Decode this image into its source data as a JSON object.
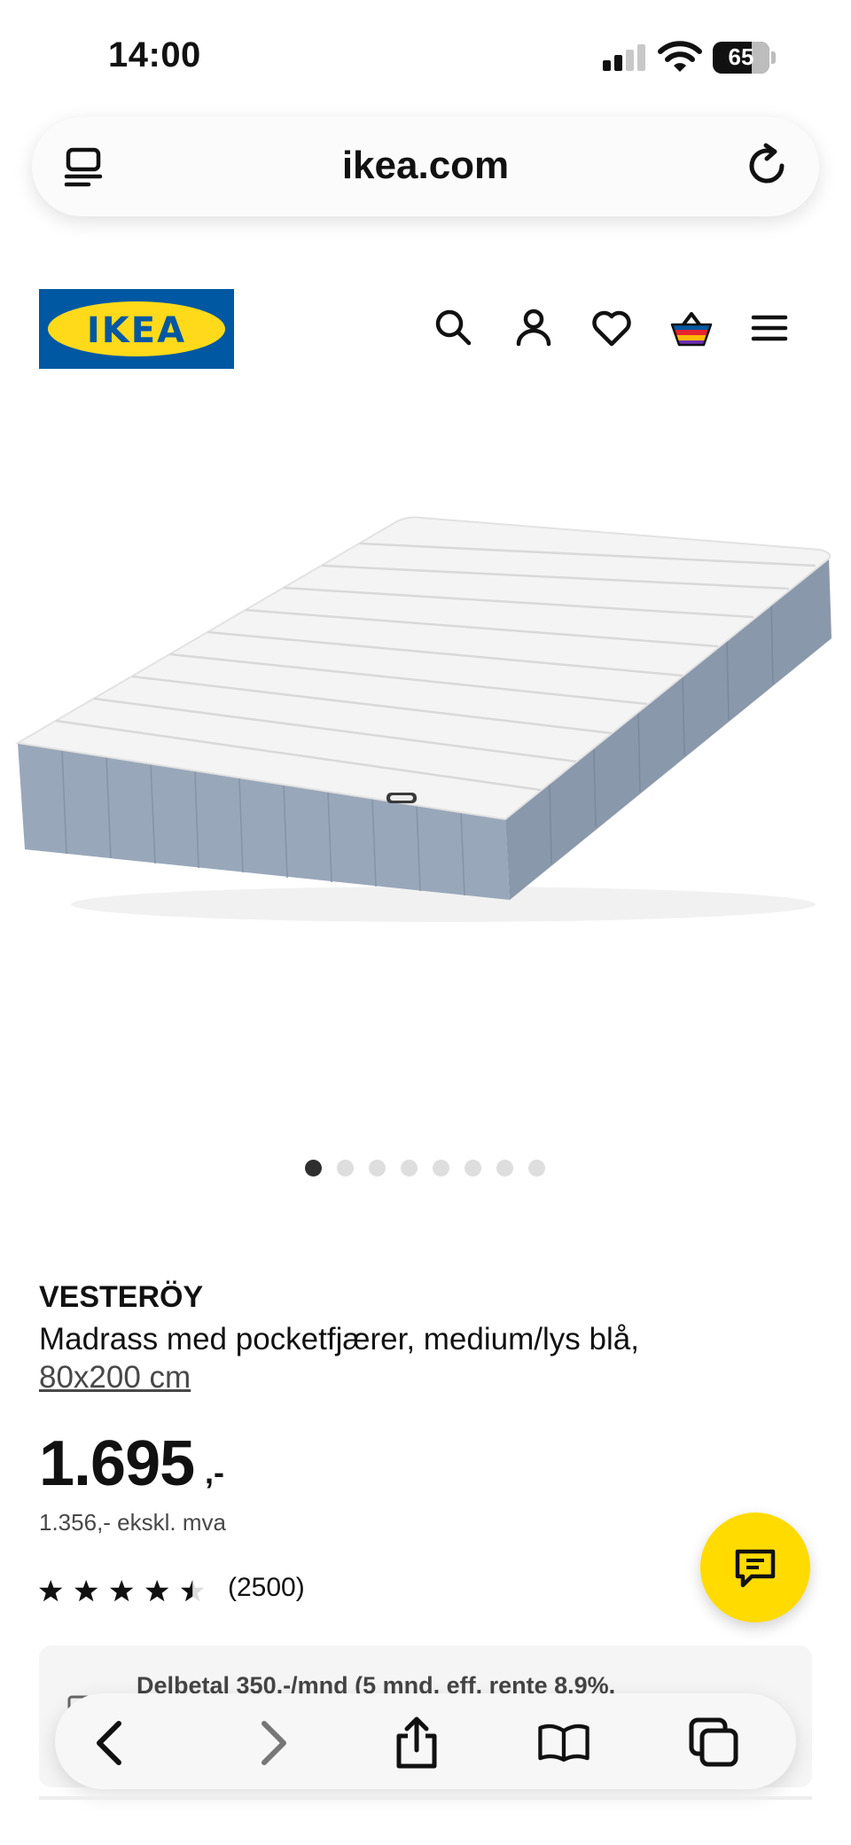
{
  "status_bar": {
    "time": "14:00",
    "battery_level": "65"
  },
  "browser": {
    "url": "ikea.com",
    "icons": [
      "tabs-overview-icon",
      "reload-icon"
    ]
  },
  "header": {
    "logo_text": "IKEA",
    "icons": [
      "search-icon",
      "account-icon",
      "heart-icon",
      "basket-icon",
      "menu-icon"
    ],
    "brand_colors": {
      "blue": "#0058a3",
      "yellow": "#ffda1a"
    }
  },
  "carousel": {
    "total": 8,
    "active_index": 0
  },
  "product": {
    "name": "VESTERÖY",
    "description": "Madrass med pocketfjærer, medium/lys blå,",
    "size": "80x200 cm",
    "price": "1.695",
    "price_suffix": ",-",
    "price_ex_vat": "1.356,- ekskl. mva",
    "rating_stars": 4.5,
    "rating_count": "(2500)"
  },
  "installment": {
    "text": "Delbetal 350,-/mnd (5 mnd, eff. rente 8.9%,"
  },
  "chat": {
    "icon": "chat-bubble-icon",
    "color": "#ffdb00"
  },
  "toolbar": {
    "icons": [
      "back-icon",
      "forward-icon",
      "share-icon",
      "bookmarks-icon",
      "tabs-icon"
    ]
  }
}
